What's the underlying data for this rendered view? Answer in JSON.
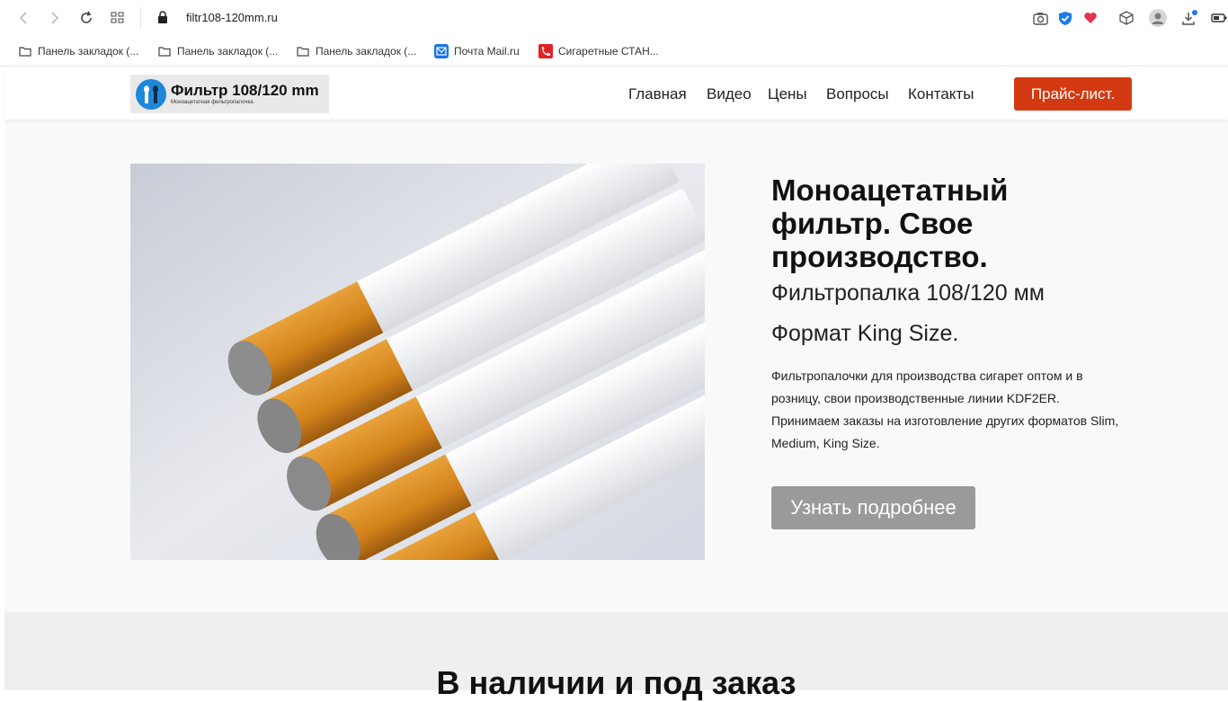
{
  "browser": {
    "url": "filtr108-120mm.ru",
    "bookmarks": [
      {
        "label": "Панель закладок (...",
        "icon": "folder-icon"
      },
      {
        "label": "Панель закладок (...",
        "icon": "folder-icon"
      },
      {
        "label": "Панель закладок (...",
        "icon": "folder-icon"
      },
      {
        "label": "Почта Mail.ru",
        "icon": "mail-icon"
      },
      {
        "label": "Сигаретные СТАН...",
        "icon": "phone-icon"
      }
    ]
  },
  "site": {
    "logo": {
      "title": "Фильтр 108/120 mm",
      "subtitle": "Моноацетатная фильтропалочка."
    },
    "menu": [
      "Главная",
      "Видео",
      "Цены",
      "Вопросы",
      "Контакты"
    ],
    "price_button": "Прайс-лист.",
    "hero": {
      "title": "Моноацетатный фильтр. Свое производство.",
      "subtitle1": "Фильтропалка 108/120 мм",
      "subtitle2": "Формат King Size.",
      "description": "Фильтропалочки для производства сигарет оптом и в розницу, свои производственные линии KDF2ER. Принимаем заказы на изготовление других форматов Slim, Medium, King Size.",
      "button": "Узнать подробнее"
    },
    "section2_title": "В наличии и под заказ"
  },
  "colors": {
    "accent": "#d43a12",
    "button_gray": "#9a9a9a",
    "logo_blue": "#1e88d8"
  }
}
